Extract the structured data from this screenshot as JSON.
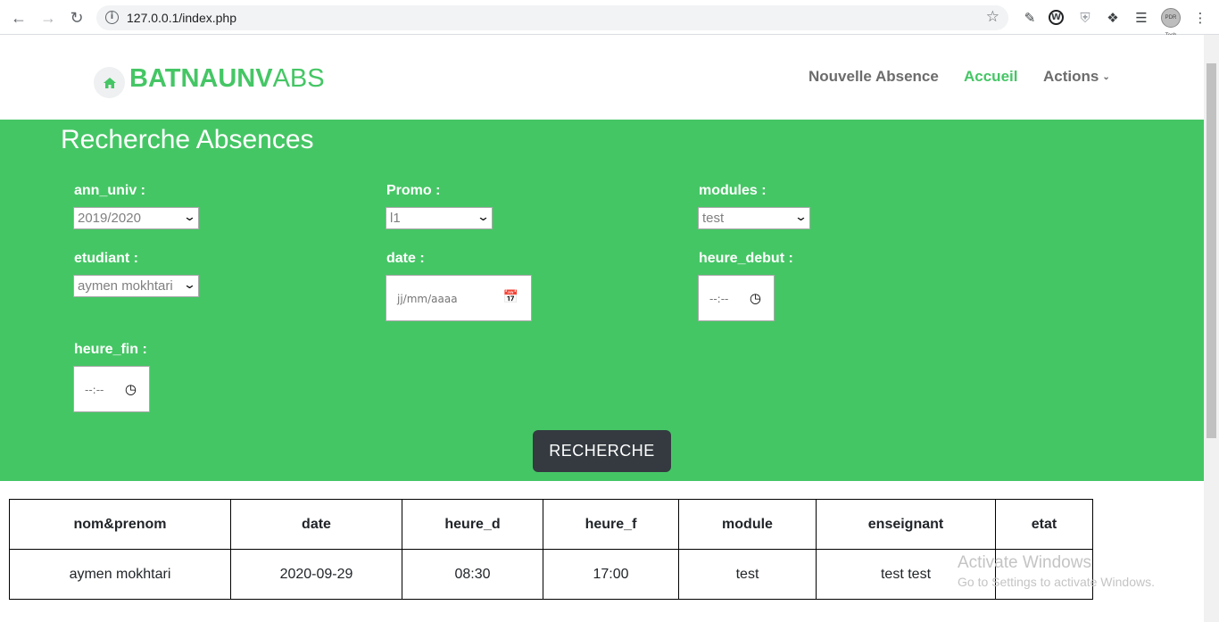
{
  "browser": {
    "url": "127.0.0.1/index.php",
    "info_icon": "info-icon",
    "profile_text": "PDR Tech"
  },
  "site": {
    "logo_bold": "BATNAUNV",
    "logo_light": "ABS",
    "nav": {
      "new_absence": "Nouvelle Absence",
      "home": "Accueil",
      "actions": "Actions"
    }
  },
  "search": {
    "title": "Recherche Absences",
    "ann_univ": {
      "label": "ann_univ :",
      "value": "2019/2020"
    },
    "promo": {
      "label": "Promo :",
      "value": "l1"
    },
    "modules": {
      "label": "modules :",
      "value": "test"
    },
    "etudiant": {
      "label": "etudiant :",
      "value": "aymen mokhtari"
    },
    "date": {
      "label": "date :",
      "placeholder": "jj/mm/aaaa"
    },
    "heure_debut": {
      "label": "heure_debut :",
      "placeholder": "--:--"
    },
    "heure_fin": {
      "label": "heure_fin :",
      "placeholder": "--:--"
    },
    "button": "RECHERCHE"
  },
  "table": {
    "headers": [
      "nom&prenom",
      "date",
      "heure_d",
      "heure_f",
      "module",
      "enseignant",
      "etat"
    ],
    "rows": [
      [
        "aymen mokhtari",
        "2020-09-29",
        "08:30",
        "17:00",
        "test",
        "test test",
        ""
      ]
    ]
  },
  "watermark": {
    "line1": "Activate Windows",
    "line2": "Go to Settings to activate Windows."
  },
  "colors": {
    "brand_green": "#45c665",
    "button_dark": "#343a40"
  }
}
